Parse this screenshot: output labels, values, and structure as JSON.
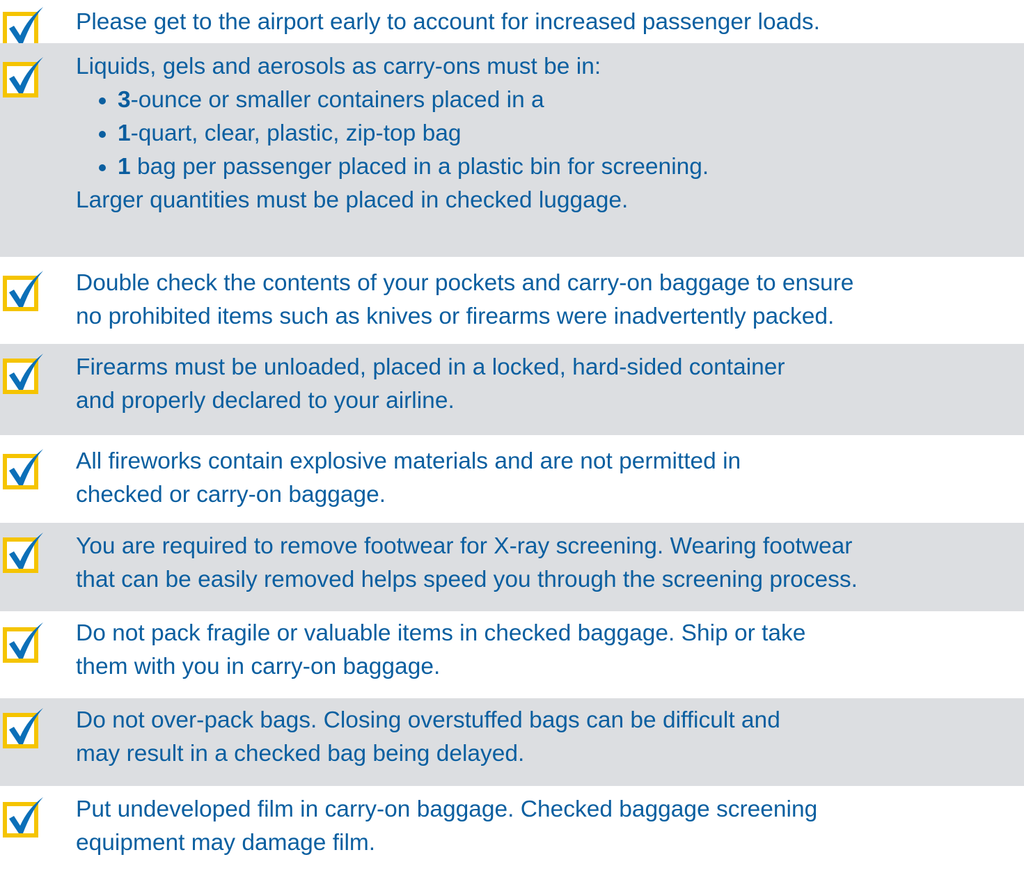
{
  "colors": {
    "text": "#0b5fa0",
    "shade": "#dcdee1",
    "check_box": "#f5c400",
    "check_mark": "#0b6fb8"
  },
  "icons": {
    "check": "checkbox-checked-icon"
  },
  "tips": [
    {
      "text": "Please get to the airport early to account for increased passenger loads."
    },
    {
      "intro": "Liquids, gels and aerosols as carry-ons must be in:",
      "bullets": [
        {
          "bold": "3",
          "rest": "-ounce or smaller containers placed in a"
        },
        {
          "bold": "1",
          "rest": "-quart, clear, plastic, zip-top bag"
        },
        {
          "bold": "1",
          "rest": " bag per passenger placed in a plastic bin for screening."
        }
      ],
      "outro": "Larger quantities must be placed in checked luggage."
    },
    {
      "line1": "Double check the contents of your pockets and carry-on baggage to ensure",
      "line2": "no prohibited items such as knives or firearms were inadvertently packed."
    },
    {
      "line1": "Firearms must be unloaded, placed in a locked, hard-sided container",
      "line2": "and properly declared to your airline."
    },
    {
      "line1": "All fireworks contain explosive materials and are not permitted in",
      "line2": "checked or carry-on baggage."
    },
    {
      "line1": "You are required to remove footwear for X-ray screening. Wearing footwear",
      "line2": "that can be easily removed helps speed you through the screening process."
    },
    {
      "line1": "Do not pack fragile or valuable items in checked baggage. Ship or take",
      "line2": "them with you in carry-on baggage."
    },
    {
      "line1": "Do not over-pack bags. Closing overstuffed bags can be difficult and",
      "line2": "may result in a checked bag being delayed."
    },
    {
      "line1": "Put undeveloped film in carry-on baggage. Checked baggage screening",
      "line2": "equipment may damage film."
    }
  ]
}
